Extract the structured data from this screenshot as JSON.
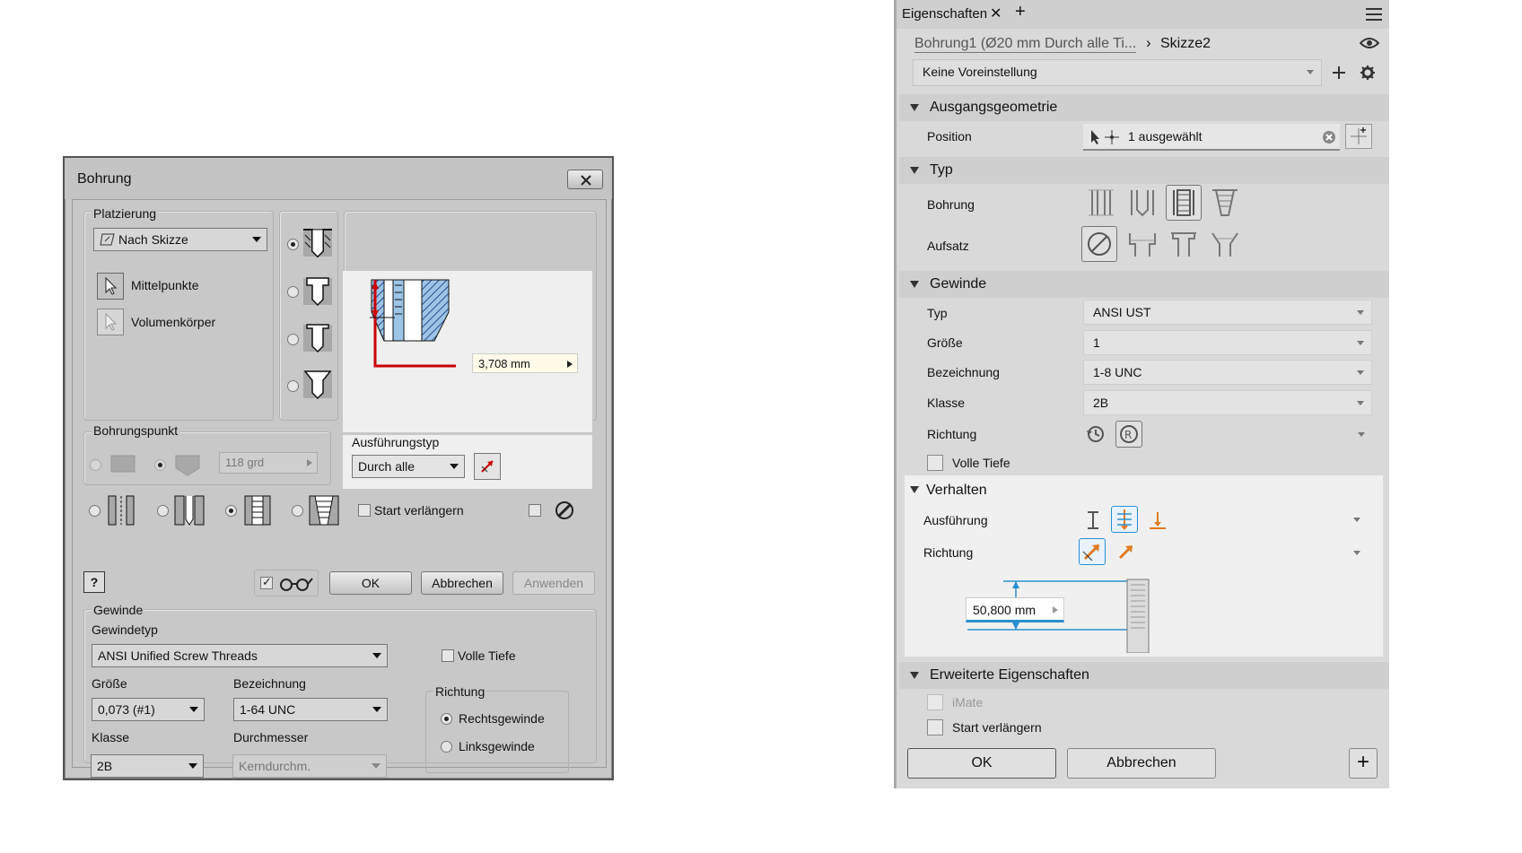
{
  "dialog": {
    "title": "Bohrung",
    "placement": {
      "group_label": "Platzierung",
      "mode_value": "Nach Skizze",
      "centers_label": "Mittelpunkte",
      "solids_label": "Volumenkörper"
    },
    "preview": {
      "distance_value": "3,708 mm"
    },
    "drillpoint": {
      "group_label": "Bohrungspunkt",
      "angle_value": "118 grd"
    },
    "termination": {
      "group_label": "Ausführungstyp",
      "value": "Durch alle"
    },
    "options": {
      "start_extend_label": "Start verlängern"
    },
    "buttons": {
      "help": "?",
      "ok": "OK",
      "cancel": "Abbrechen",
      "apply": "Anwenden"
    },
    "thread": {
      "group_label": "Gewinde",
      "type_label": "Gewindetyp",
      "type_value": "ANSI Unified Screw Threads",
      "full_depth_label": "Volle Tiefe",
      "size_label": "Größe",
      "size_value": "0,073 (#1)",
      "designation_label": "Bezeichnung",
      "designation_value": "1-64 UNC",
      "class_label": "Klasse",
      "class_value": "2B",
      "diameter_label": "Durchmesser",
      "diameter_value": "Kerndurchm.",
      "direction_label": "Richtung",
      "right_hand_label": "Rechtsgewinde",
      "left_hand_label": "Linksgewinde"
    }
  },
  "panel": {
    "tab_label": "Eigenschaften",
    "tab_close": "✕",
    "tab_add": "+",
    "menu_icon": "hamburger-icon",
    "breadcrumb": {
      "feature": "Bohrung1 (Ø20 mm Durch alle Ti...",
      "separator": "›",
      "sketch": "Skizze2"
    },
    "preset_value": "Keine Voreinstellung",
    "sections": {
      "input_geometry": {
        "title": "Ausgangsgeometrie",
        "position_label": "Position",
        "position_value": "1 ausgewählt"
      },
      "type": {
        "title": "Typ",
        "hole_label": "Bohrung",
        "seat_label": "Aufsatz"
      },
      "thread": {
        "title": "Gewinde",
        "type_label": "Typ",
        "type_value": "ANSI UST",
        "size_label": "Größe",
        "size_value": "1",
        "designation_label": "Bezeichnung",
        "designation_value": "1-8 UNC",
        "class_label": "Klasse",
        "class_value": "2B",
        "direction_label": "Richtung",
        "full_depth_label": "Volle Tiefe"
      },
      "behavior": {
        "title": "Verhalten",
        "termination_label": "Ausführung",
        "direction_label": "Richtung",
        "depth_value": "50,800 mm"
      },
      "advanced": {
        "title": "Erweiterte Eigenschaften",
        "imate_label": "iMate",
        "start_extend_label": "Start verlängern"
      }
    },
    "buttons": {
      "ok": "OK",
      "cancel": "Abbrechen",
      "add": "+"
    }
  },
  "colors": {
    "accent_blue": "#2a8fd0",
    "accent_orange": "#e07a20",
    "dimension_red": "#cc0000"
  }
}
